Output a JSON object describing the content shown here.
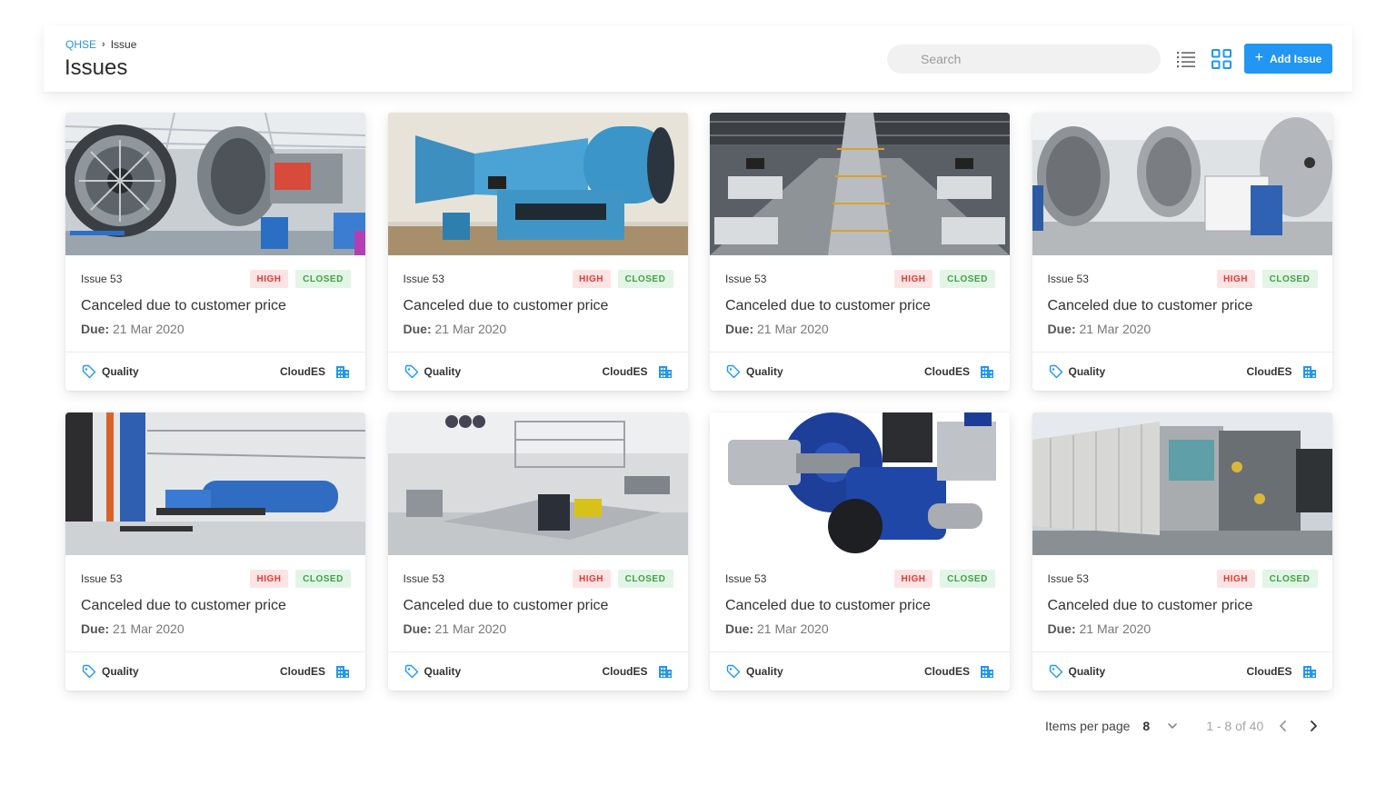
{
  "header": {
    "breadcrumb": {
      "root": "QHSE",
      "current": "Issue"
    },
    "title": "Issues",
    "search_placeholder": "Search",
    "add_button_label": "Add Issue"
  },
  "colors": {
    "accent": "#2196f3",
    "high_text": "#e53935",
    "high_bg": "#fde4e4",
    "closed_text": "#43a047",
    "closed_bg": "#e2f5e6"
  },
  "icons": [
    "list-view-icon",
    "grid-view-icon",
    "plus-icon",
    "tag-icon",
    "building-icon",
    "chevron-down-icon",
    "chevron-left-icon",
    "chevron-right-icon"
  ],
  "cards": [
    {
      "issue_id": "Issue 53",
      "priority": "HIGH",
      "status": "CLOSED",
      "title": "Canceled due to customer price",
      "due_label": "Due:",
      "due_date": " 21 Mar 2020",
      "category": "Quality",
      "org": "CloudES",
      "image": "jet engine"
    },
    {
      "issue_id": "Issue 53",
      "priority": "HIGH",
      "status": "CLOSED",
      "title": "Canceled due to customer price",
      "due_label": "Due:",
      "due_date": " 21 Mar 2020",
      "category": "Quality",
      "org": "CloudES",
      "image": "blue wind tunnel"
    },
    {
      "issue_id": "Issue 53",
      "priority": "HIGH",
      "status": "CLOSED",
      "title": "Canceled due to customer price",
      "due_label": "Due:",
      "due_date": " 21 Mar 2020",
      "category": "Quality",
      "org": "CloudES",
      "image": "fuselage assembly"
    },
    {
      "issue_id": "Issue 53",
      "priority": "HIGH",
      "status": "CLOSED",
      "title": "Canceled due to customer price",
      "due_label": "Due:",
      "due_date": " 21 Mar 2020",
      "category": "Quality",
      "org": "CloudES",
      "image": "vacuum chambers"
    },
    {
      "issue_id": "Issue 53",
      "priority": "HIGH",
      "status": "CLOSED",
      "title": "Canceled due to customer price",
      "due_label": "Due:",
      "due_date": " 21 Mar 2020",
      "category": "Quality",
      "org": "CloudES",
      "image": "blue tunnel hall"
    },
    {
      "issue_id": "Issue 53",
      "priority": "HIGH",
      "status": "CLOSED",
      "title": "Canceled due to customer price",
      "due_label": "Due:",
      "due_date": " 21 Mar 2020",
      "category": "Quality",
      "org": "CloudES",
      "image": "clean room"
    },
    {
      "issue_id": "Issue 53",
      "priority": "HIGH",
      "status": "CLOSED",
      "title": "Canceled due to customer price",
      "due_label": "Due:",
      "due_date": " 21 Mar 2020",
      "category": "Quality",
      "org": "CloudES",
      "image": "burner unit"
    },
    {
      "issue_id": "Issue 53",
      "priority": "HIGH",
      "status": "CLOSED",
      "title": "Canceled due to customer price",
      "due_label": "Due:",
      "due_date": " 21 Mar 2020",
      "category": "Quality",
      "org": "CloudES",
      "image": "container unit"
    }
  ],
  "pagination": {
    "items_per_page_label": "Items per page",
    "items_per_page": "8",
    "range": "1 - 8 of 40"
  }
}
